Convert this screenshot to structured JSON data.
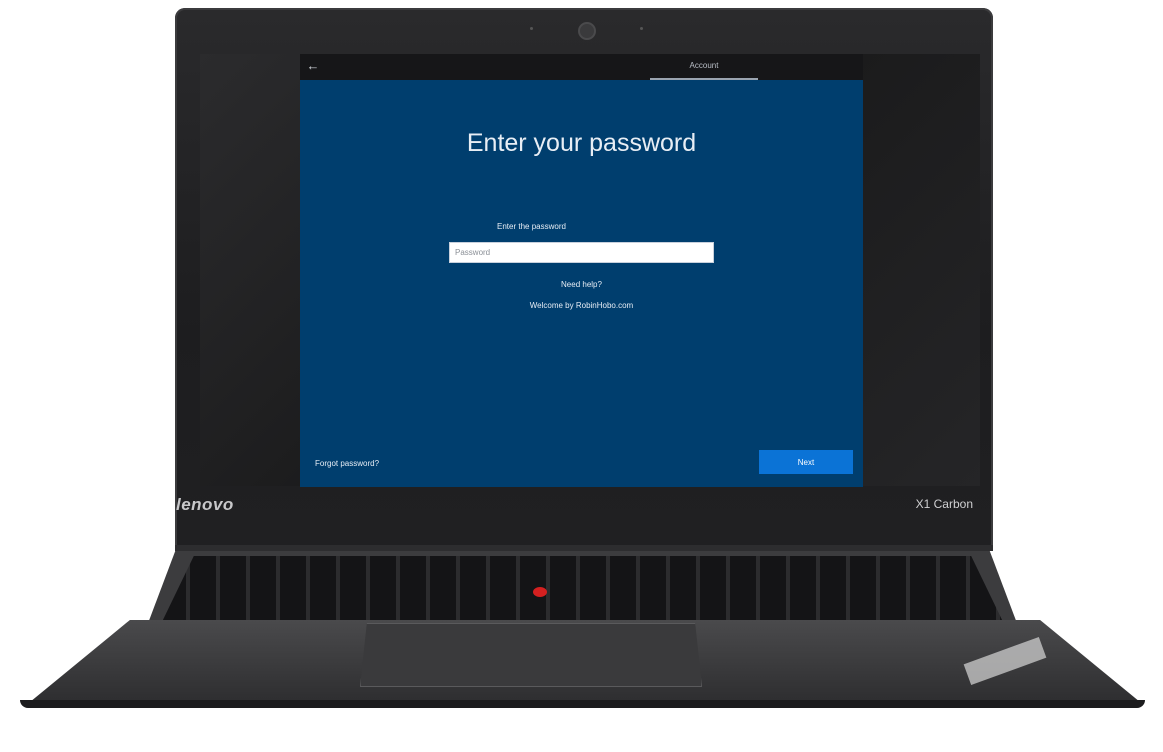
{
  "device": {
    "brand": "lenovo",
    "model": "X1 Carbon"
  },
  "titlebar": {
    "back_icon": "←",
    "tab_label": "Account"
  },
  "main": {
    "title": "Enter your password",
    "password_label": "Enter the password",
    "password_placeholder": "Password",
    "password_value": "",
    "need_help": "Need help?",
    "welcome": "Welcome by RobinHobo.com"
  },
  "footer": {
    "forgot_password": "Forgot password?",
    "next_label": "Next"
  },
  "colors": {
    "window_bg": "#003e6e",
    "titlebar_bg": "#161618",
    "next_button": "#0b73d6",
    "trackpoint": "#d42020"
  }
}
